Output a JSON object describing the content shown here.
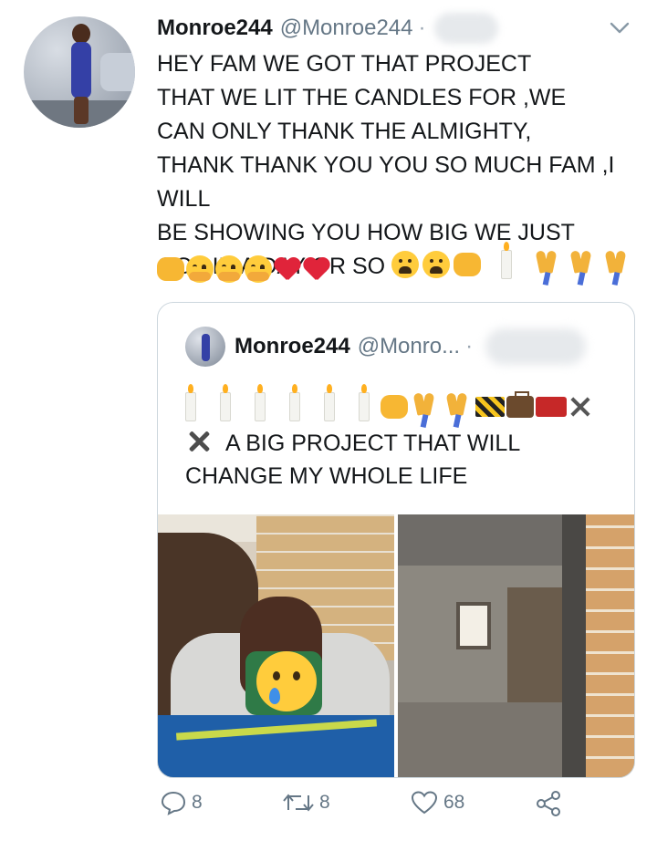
{
  "tweet": {
    "name": "Monroe244",
    "handle": "@Monroe244",
    "separator": "·",
    "text_lines": [
      "HEY FAM WE GOT THAT PROJECT",
      "THAT WE LIT THE CANDLES FOR ,WE",
      "CAN ONLY THANK THE ALMIGHTY,",
      "THANK THANK YOU YOU SO MUCH FAM ,I WILL",
      "BE SHOWING YOU HOW BIG WE JUST",
      "GOT IN A DAY OR SO"
    ],
    "icons": {
      "inline_end": [
        "tired-face-icon",
        "tired-face-icon",
        "open-hands-icon",
        "candle-icon",
        "praying-hands-icon",
        "praying-hands-icon",
        "praying-hands-icon"
      ],
      "second_row": [
        "open-hands-icon",
        "hugging-face-icon",
        "hugging-face-icon",
        "hugging-face-icon",
        "red-heart-icon",
        "red-heart-icon"
      ]
    }
  },
  "quoted": {
    "name": "Monroe244",
    "handle": "@Monro...",
    "separator": "·",
    "text_line_1": "A BIG PROJECT THAT WILL",
    "text_line_2": "CHANGE MY WHOLE LIFE",
    "icons": [
      "candle-icon",
      "candle-icon",
      "candle-icon",
      "candle-icon",
      "candle-icon",
      "candle-icon",
      "open-hands-icon",
      "praying-hands-icon",
      "praying-hands-icon",
      "construction-barrier-icon",
      "briefcase-icon",
      "toolbox-icon",
      "hammer-pick-icon",
      "hammer-wrench-icon"
    ]
  },
  "actions": {
    "reply_count": "8",
    "retweet_count": "8",
    "like_count": "68"
  },
  "colors": {
    "text": "#14171a",
    "secondary": "#657786",
    "border": "#ccd6dd"
  }
}
